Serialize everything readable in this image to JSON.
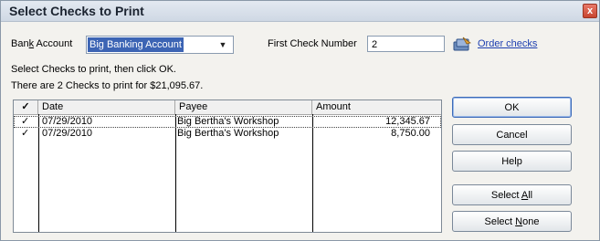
{
  "window": {
    "title": "Select Checks to Print",
    "close_label": "x"
  },
  "bank_account": {
    "label_pre": "Ban",
    "label_u": "k",
    "label_post": " Account",
    "value": "Big Banking Account",
    "arrow": "▼"
  },
  "first_check": {
    "label": "First Check Number",
    "value": "2"
  },
  "order_checks": {
    "label": "Order checks",
    "icon": "order-checks-icon"
  },
  "instructions": {
    "line1": "Select Checks to print, then click OK.",
    "line2": "There are 2 Checks to print for $21,095.67."
  },
  "table": {
    "headers": {
      "check": "✓",
      "date": "Date",
      "payee": "Payee",
      "amount": "Amount"
    },
    "rows": [
      {
        "check": "✓",
        "date": "07/29/2010",
        "payee": "Big Bertha's Workshop",
        "amount": "12,345.67"
      },
      {
        "check": "✓",
        "date": "07/29/2010",
        "payee": "Big Bertha's Workshop",
        "amount": "8,750.00"
      }
    ]
  },
  "buttons": {
    "ok": "OK",
    "cancel": "Cancel",
    "help": "Help",
    "select_all": {
      "pre": "Select ",
      "u": "A",
      "post": "ll"
    },
    "select_none": {
      "pre": "Select ",
      "u": "N",
      "post": "one"
    }
  }
}
